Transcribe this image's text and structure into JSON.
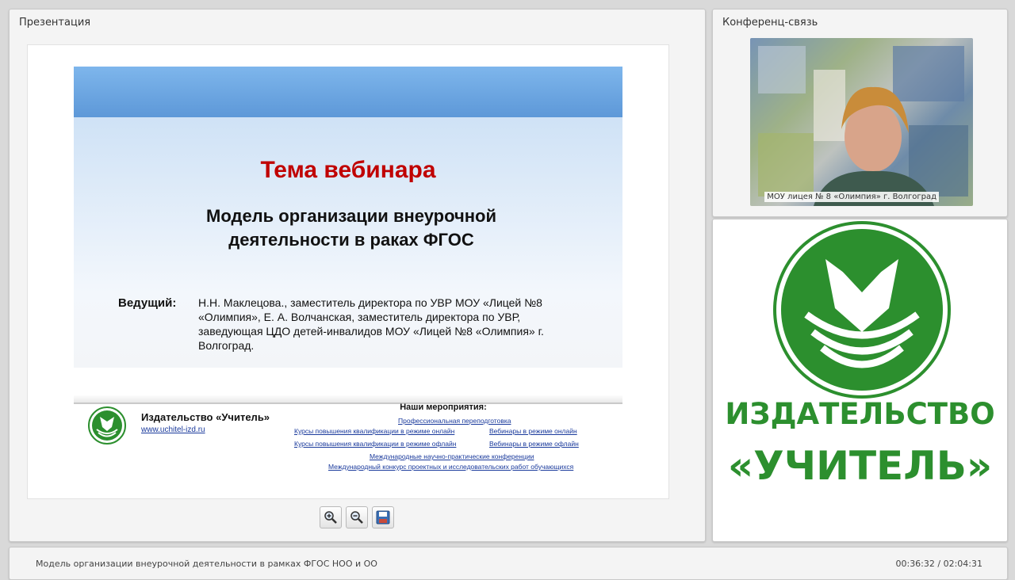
{
  "presentation_panel": {
    "title": "Презентация"
  },
  "slide": {
    "topic": "Тема вебинара",
    "subtitle": "Модель организации внеурочной деятельности в раках ФГОС",
    "host_label": "Ведущий:",
    "host_text": "Н.Н. Маклецова., заместитель директора по УВР МОУ  «Лицей №8 «Олимпия», Е. А. Волчанская, заместитель директора по УВР, заведующая ЦДО детей-инвалидов МОУ «Лицей №8 «Олимпия» г. Волгоград.",
    "publisher_name": "Издательство «Учитель»",
    "publisher_link": "www.uchitel-izd.ru",
    "events_title": "Наши мероприятия:",
    "events": [
      "Профессиональная переподготовка",
      "Курсы повышения квалификации в режиме онлайн",
      "Вебинары в режиме онлайн",
      "Курсы повышения квалификации в режиме офлайн",
      "Вебинары в режиме офлайн",
      "Международные научно-практические конференции",
      "Международный конкурс проектных и исследовательских работ обучающихся"
    ]
  },
  "toolbar": {
    "zoom_in_icon": "zoom-in-icon",
    "zoom_out_icon": "zoom-out-icon",
    "save_icon": "floppy-disk-icon"
  },
  "conference_panel": {
    "title": "Конференц-связь",
    "video_caption": "МОУ лицея № 8 «Олимпия» г. Волгоград"
  },
  "brand": {
    "line1": "ИЗДАТЕЛЬСТВО",
    "line2": "«УЧИТЕЛЬ»",
    "color": "#2c8f2e"
  },
  "status_bar": {
    "title": "Модель организации внеурочной деятельности в рамках ФГОС НОО и ОО",
    "time": "00:36:32 / 02:04:31"
  }
}
